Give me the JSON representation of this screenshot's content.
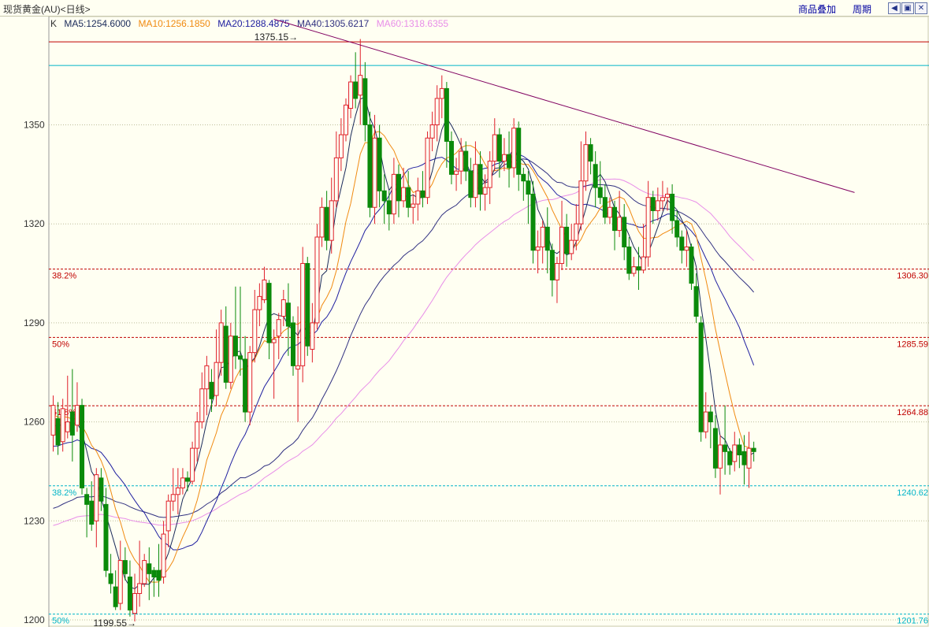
{
  "window": {
    "title": "现货黄金(AU)<日线>",
    "overlay_label": "商品叠加",
    "period_label": "周期",
    "nav_icons": [
      "arrow-left-icon",
      "arrow-expand-icon",
      "arrow-right-icon",
      "close-icon"
    ]
  },
  "legend": {
    "k_label": "K",
    "ma5": "MA5:1254.6000",
    "ma10": "MA10:1256.1850",
    "ma20": "MA20:1288.4875",
    "ma40": "MA40:1305.6217",
    "ma60": "MA60:1318.6355"
  },
  "colors": {
    "background": "#fffff2",
    "up": "#e0202a",
    "down": "#0a8a0a",
    "ma5": "#1a2a5a",
    "ma10": "#f08a10",
    "ma20": "#2020a0",
    "ma40": "#303080",
    "ma60": "#e88ee8",
    "trendline": "#800060",
    "fib_red": "#c00000",
    "fib_cyan": "#00b4c8"
  },
  "chart_data": {
    "type": "candlestick",
    "y_axis": {
      "ylim": [
        1200,
        1380
      ],
      "ticks": [
        "1200",
        "1230",
        "1260",
        "1290",
        "1320",
        "1350"
      ],
      "tick_values": [
        1200,
        1230,
        1260,
        1290,
        1320,
        1350
      ]
    },
    "grid": true,
    "high_marker": {
      "label": "1375.15",
      "value": 1375.15,
      "bar": 52
    },
    "low_marker": {
      "label": "1199.55",
      "value": 1199.55,
      "bar": 17
    },
    "horizontal_lines": [
      {
        "value": 1375.15,
        "color": "fib_red",
        "style": "solid"
      },
      {
        "value": 1368.0,
        "color": "fib_cyan",
        "style": "solid"
      }
    ],
    "fib_levels": [
      {
        "pct": "38.2%",
        "price": "1306.30",
        "value": 1306.3,
        "color": "fib_red"
      },
      {
        "pct": "50%",
        "price": "1285.59",
        "value": 1285.59,
        "color": "fib_red"
      },
      {
        "pct": "61.8%",
        "price": "1264.88",
        "value": 1264.88,
        "color": "fib_red"
      },
      {
        "pct": "38.2%",
        "price": "1240.62",
        "value": 1240.62,
        "color": "fib_cyan"
      },
      {
        "pct": "50%",
        "price": "1201.76",
        "value": 1201.76,
        "color": "fib_cyan"
      }
    ],
    "trendline": {
      "from": {
        "bar": 46,
        "value": 1382
      },
      "to": {
        "bar": 167,
        "value": 1329.5
      }
    },
    "candles": [
      [
        1256,
        1265,
        1251,
        1268
      ],
      [
        1261,
        1253,
        1250,
        1266
      ],
      [
        1254,
        1264,
        1251,
        1267
      ],
      [
        1257,
        1260,
        1255,
        1274
      ],
      [
        1263,
        1256,
        1248,
        1276
      ],
      [
        1259,
        1265,
        1257,
        1272
      ],
      [
        1265,
        1240,
        1238,
        1267
      ],
      [
        1238,
        1235,
        1225,
        1240
      ],
      [
        1236,
        1229,
        1227,
        1242
      ],
      [
        1230,
        1244,
        1222,
        1246
      ],
      [
        1243,
        1236,
        1233,
        1246
      ],
      [
        1235,
        1215,
        1213,
        1240
      ],
      [
        1214,
        1211,
        1208,
        1220
      ],
      [
        1210,
        1204,
        1203,
        1215
      ],
      [
        1205,
        1218,
        1203,
        1224
      ],
      [
        1218,
        1214,
        1212,
        1222
      ],
      [
        1213,
        1203,
        1201,
        1218
      ],
      [
        1202,
        1208,
        1199.55,
        1214
      ],
      [
        1208,
        1211,
        1204,
        1224
      ],
      [
        1211,
        1218,
        1210,
        1220
      ],
      [
        1217,
        1214,
        1206,
        1222
      ],
      [
        1215,
        1213,
        1207,
        1216
      ],
      [
        1215,
        1212,
        1207,
        1223
      ],
      [
        1213,
        1226,
        1211,
        1230
      ],
      [
        1227,
        1236,
        1222,
        1238
      ],
      [
        1236,
        1238,
        1233,
        1246
      ],
      [
        1238,
        1240,
        1232,
        1246
      ],
      [
        1240,
        1243,
        1238,
        1246
      ],
      [
        1243,
        1242,
        1239,
        1245
      ],
      [
        1242,
        1252,
        1241,
        1254
      ],
      [
        1252,
        1260,
        1248,
        1263
      ],
      [
        1260,
        1270,
        1258,
        1275
      ],
      [
        1270,
        1277,
        1262,
        1280
      ],
      [
        1272,
        1267,
        1263,
        1276
      ],
      [
        1268,
        1278,
        1265,
        1288
      ],
      [
        1278,
        1290,
        1274,
        1294
      ],
      [
        1289,
        1272,
        1270,
        1295
      ],
      [
        1272,
        1286,
        1270,
        1290
      ],
      [
        1286,
        1280,
        1276,
        1301
      ],
      [
        1280,
        1279,
        1274,
        1301
      ],
      [
        1279,
        1263,
        1260,
        1286
      ],
      [
        1263,
        1281,
        1259,
        1283
      ],
      [
        1281,
        1294,
        1278,
        1300
      ],
      [
        1294,
        1298,
        1289,
        1302
      ],
      [
        1297,
        1303,
        1296,
        1307
      ],
      [
        1302,
        1284,
        1279,
        1303
      ],
      [
        1284,
        1285,
        1267,
        1288
      ],
      [
        1286,
        1291,
        1279,
        1293
      ],
      [
        1292,
        1297,
        1289,
        1300
      ],
      [
        1296,
        1289,
        1280,
        1302
      ],
      [
        1290,
        1277,
        1274,
        1292
      ],
      [
        1276,
        1277,
        1260,
        1295
      ],
      [
        1277,
        1308,
        1272,
        1313
      ],
      [
        1308,
        1283,
        1280,
        1310
      ],
      [
        1282,
        1290,
        1278,
        1296
      ],
      [
        1290,
        1316,
        1288,
        1320
      ],
      [
        1316,
        1325,
        1313,
        1328
      ],
      [
        1325,
        1315,
        1312,
        1330
      ],
      [
        1315,
        1327,
        1311,
        1334
      ],
      [
        1327,
        1340,
        1325,
        1348
      ],
      [
        1340,
        1347,
        1336,
        1352
      ],
      [
        1347,
        1356,
        1345,
        1358
      ],
      [
        1355,
        1363,
        1352,
        1365
      ],
      [
        1363,
        1358,
        1355,
        1372
      ],
      [
        1359,
        1365,
        1350,
        1376
      ],
      [
        1364,
        1350,
        1345,
        1369
      ],
      [
        1350,
        1325,
        1322,
        1354
      ],
      [
        1325,
        1346,
        1320,
        1353
      ],
      [
        1346,
        1330,
        1325,
        1350
      ],
      [
        1330,
        1327,
        1320,
        1335
      ],
      [
        1327,
        1323,
        1318,
        1330
      ],
      [
        1323,
        1335,
        1320,
        1340
      ],
      [
        1335,
        1327,
        1322,
        1338
      ],
      [
        1327,
        1331,
        1325,
        1337
      ],
      [
        1331,
        1325,
        1322,
        1336
      ],
      [
        1325,
        1326,
        1320,
        1329
      ],
      [
        1326,
        1330,
        1321,
        1334
      ],
      [
        1330,
        1328,
        1325,
        1336
      ],
      [
        1328,
        1346,
        1326,
        1348
      ],
      [
        1346,
        1350,
        1342,
        1354
      ],
      [
        1350,
        1358,
        1345,
        1362
      ],
      [
        1358,
        1361,
        1352,
        1365
      ],
      [
        1361,
        1345,
        1337,
        1363
      ],
      [
        1345,
        1335,
        1332,
        1348
      ],
      [
        1335,
        1336,
        1330,
        1340
      ],
      [
        1336,
        1342,
        1332,
        1346
      ],
      [
        1342,
        1336,
        1333,
        1345
      ],
      [
        1336,
        1328,
        1325,
        1340
      ],
      [
        1328,
        1338,
        1325,
        1345
      ],
      [
        1338,
        1329,
        1324,
        1342
      ],
      [
        1329,
        1331,
        1324,
        1335
      ],
      [
        1331,
        1339,
        1326,
        1342
      ],
      [
        1339,
        1347,
        1336,
        1352
      ],
      [
        1347,
        1339,
        1334,
        1349
      ],
      [
        1339,
        1341,
        1336,
        1346
      ],
      [
        1341,
        1337,
        1331,
        1348
      ],
      [
        1337,
        1349,
        1334,
        1352
      ],
      [
        1349,
        1335,
        1330,
        1351
      ],
      [
        1335,
        1333,
        1327,
        1337
      ],
      [
        1333,
        1329,
        1320,
        1336
      ],
      [
        1329,
        1312,
        1308,
        1333
      ],
      [
        1312,
        1313,
        1305,
        1318
      ],
      [
        1313,
        1319,
        1308,
        1321
      ],
      [
        1319,
        1312,
        1305,
        1325
      ],
      [
        1312,
        1303,
        1298,
        1314
      ],
      [
        1303,
        1308,
        1296,
        1310
      ],
      [
        1308,
        1319,
        1306,
        1327
      ],
      [
        1319,
        1311,
        1307,
        1323
      ],
      [
        1311,
        1315,
        1309,
        1320
      ],
      [
        1315,
        1320,
        1312,
        1326
      ],
      [
        1320,
        1333,
        1318,
        1345
      ],
      [
        1333,
        1344,
        1330,
        1348
      ],
      [
        1344,
        1339,
        1335,
        1346
      ],
      [
        1338,
        1331,
        1325,
        1342
      ],
      [
        1331,
        1328,
        1326,
        1339
      ],
      [
        1328,
        1322,
        1320,
        1332
      ],
      [
        1322,
        1325,
        1320,
        1328
      ],
      [
        1325,
        1318,
        1312,
        1327
      ],
      [
        1318,
        1322,
        1316,
        1330
      ],
      [
        1322,
        1313,
        1309,
        1326
      ],
      [
        1313,
        1305,
        1303,
        1316
      ],
      [
        1305,
        1307,
        1304,
        1310
      ],
      [
        1307,
        1306,
        1300,
        1313
      ],
      [
        1306,
        1310,
        1305,
        1320
      ],
      [
        1310,
        1328,
        1307,
        1333
      ],
      [
        1328,
        1324,
        1320,
        1330
      ],
      [
        1324,
        1327,
        1321,
        1331
      ],
      [
        1327,
        1328,
        1324,
        1333
      ],
      [
        1328,
        1329,
        1324,
        1331
      ],
      [
        1329,
        1321,
        1317,
        1332
      ],
      [
        1321,
        1316,
        1313,
        1324
      ],
      [
        1316,
        1312,
        1308,
        1318
      ],
      [
        1312,
        1313,
        1307,
        1318
      ],
      [
        1313,
        1302,
        1300,
        1314
      ],
      [
        1301,
        1292,
        1290,
        1305
      ],
      [
        1290,
        1257,
        1254,
        1292
      ],
      [
        1257,
        1263,
        1255,
        1269
      ],
      [
        1263,
        1260,
        1252,
        1265
      ],
      [
        1258,
        1246,
        1243,
        1262
      ],
      [
        1246,
        1253,
        1238,
        1256
      ],
      [
        1253,
        1251,
        1244,
        1265
      ],
      [
        1251,
        1247,
        1244,
        1252
      ],
      [
        1248,
        1253,
        1245,
        1257
      ],
      [
        1253,
        1250,
        1246,
        1255
      ],
      [
        1251,
        1247,
        1241,
        1256
      ],
      [
        1246,
        1252,
        1240,
        1257
      ],
      [
        1252,
        1251,
        1248,
        1254
      ]
    ]
  }
}
